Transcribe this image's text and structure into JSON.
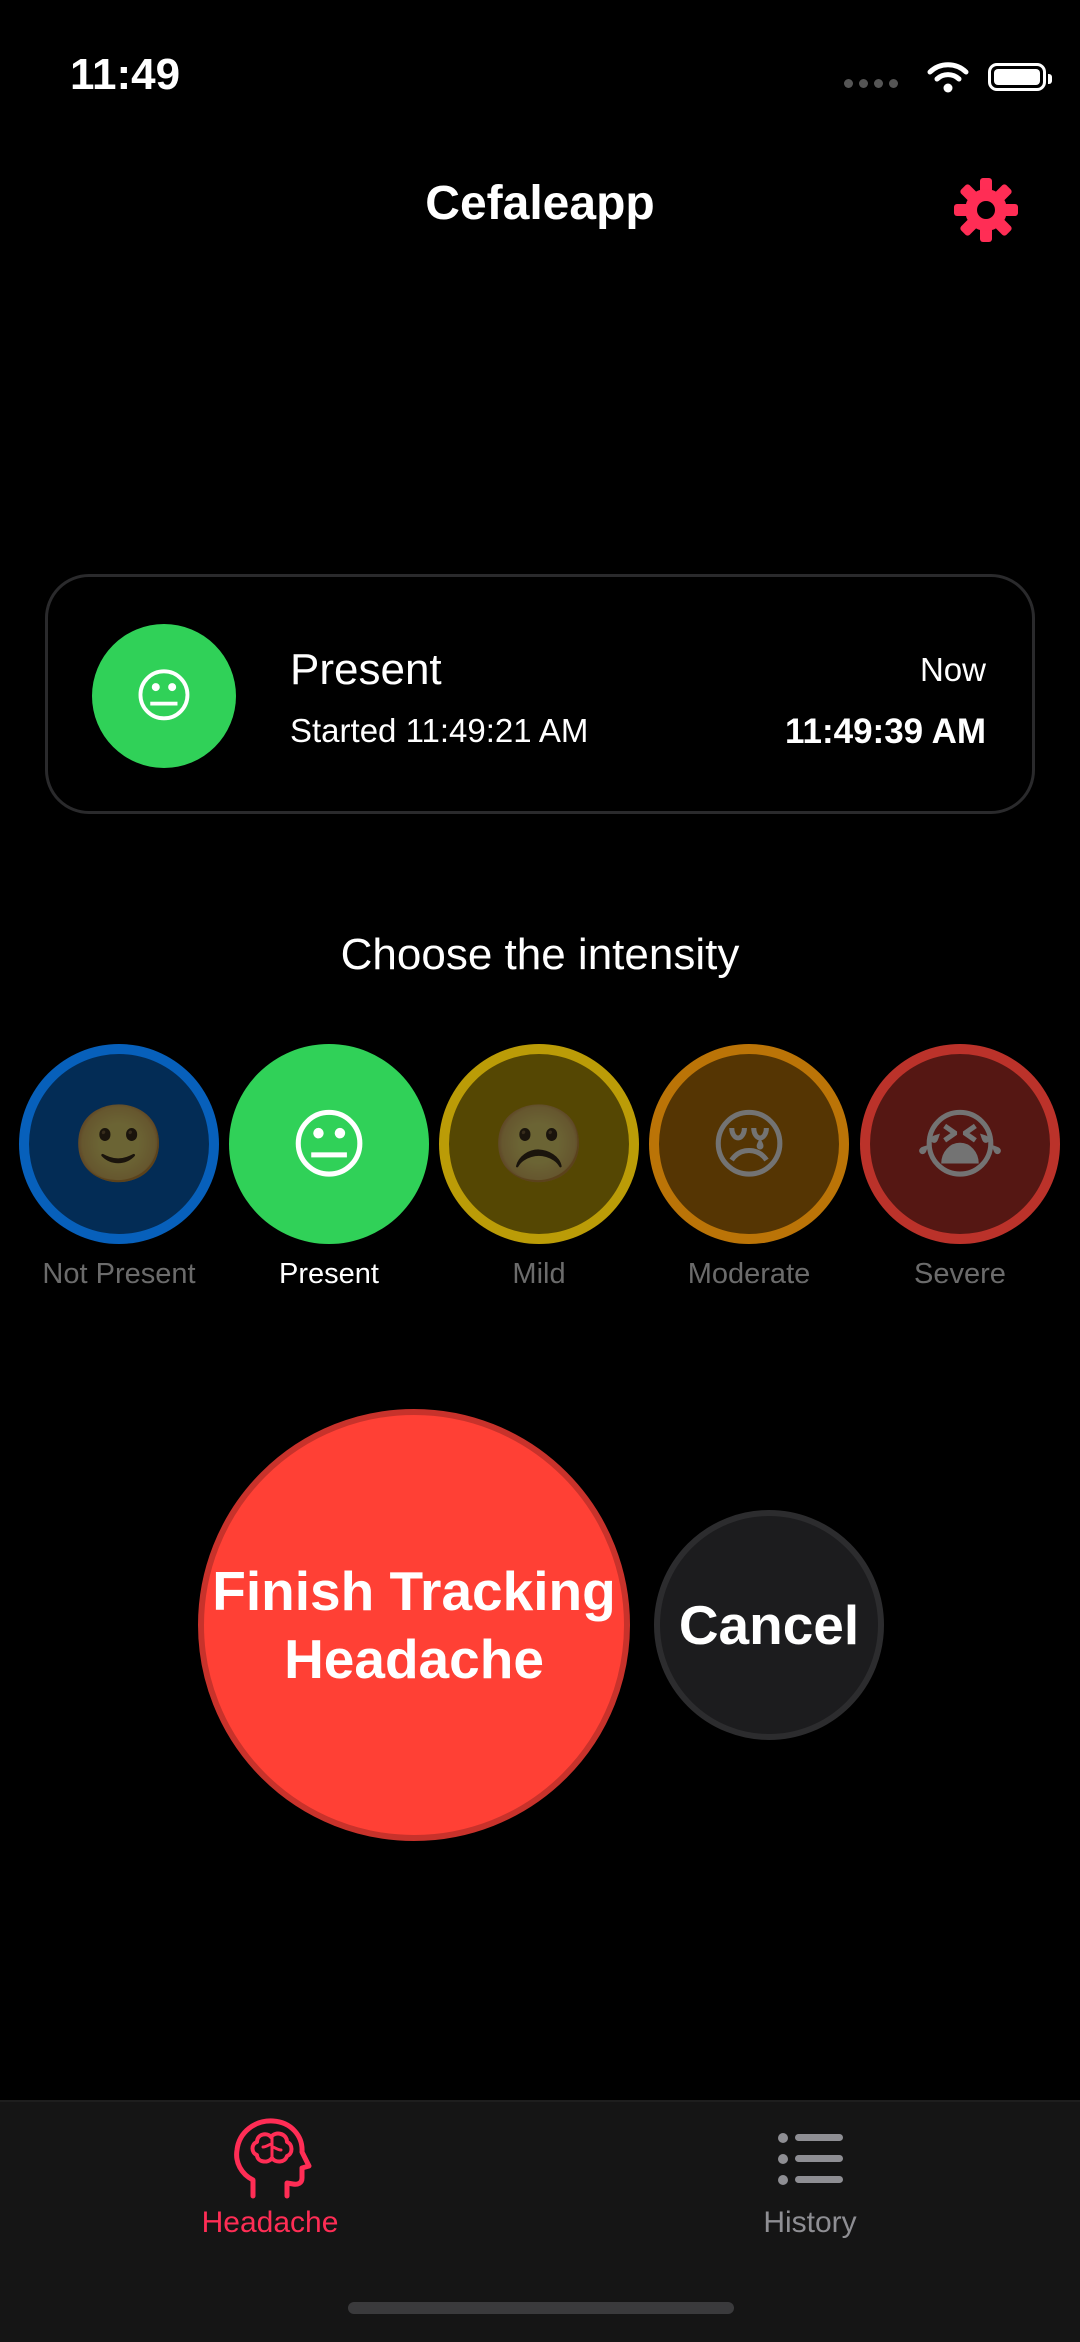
{
  "status_bar": {
    "time": "11:49"
  },
  "nav": {
    "title": "Cefaleapp",
    "settings_icon": "gear-icon",
    "accent": "#ff2d55"
  },
  "current": {
    "level": "Present",
    "emoji": "😐",
    "color": "#30d158",
    "started_label": "Started 11:49:21 AM",
    "now_label": "Now",
    "now_time": "11:49:39 AM"
  },
  "intensity": {
    "prompt": "Choose the intensity",
    "selected": "Present",
    "options": [
      {
        "label": "Not Present",
        "emoji": "🙂",
        "color": "#0a84ff"
      },
      {
        "label": "Present",
        "emoji": "😐",
        "color": "#30d158"
      },
      {
        "label": "Mild",
        "emoji": "☹️",
        "color": "#ffd60a"
      },
      {
        "label": "Moderate",
        "emoji": "😢",
        "color": "#ff9f0a"
      },
      {
        "label": "Severe",
        "emoji": "😭",
        "color": "#ff453a"
      }
    ]
  },
  "actions": {
    "finish_line1": "Finish Tracking",
    "finish_line2": "Headache",
    "cancel": "Cancel"
  },
  "tabs": [
    {
      "label": "Headache",
      "icon": "brain-head-icon",
      "active": true,
      "color": "#ff2d55"
    },
    {
      "label": "History",
      "icon": "list-icon",
      "active": false,
      "color": "#8e8e93"
    }
  ]
}
